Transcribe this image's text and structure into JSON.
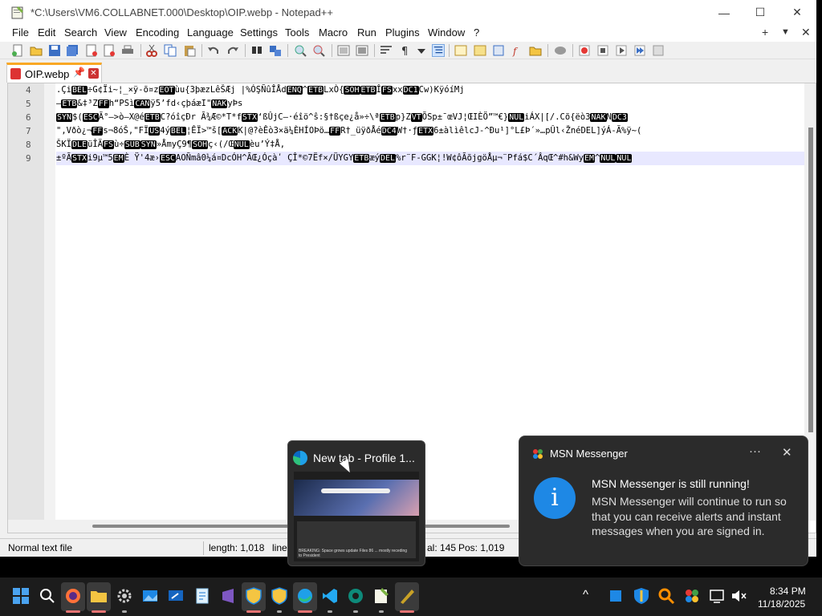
{
  "titlebar": {
    "title": "*C:\\Users\\VM6.COLLABNET.000\\Desktop\\OIP.webp - Notepad++",
    "minimize": "—",
    "maximize": "☐",
    "close": "✕"
  },
  "menu": {
    "items": [
      "File",
      "Edit",
      "Search",
      "View",
      "Encoding",
      "Language",
      "Settings",
      "Tools",
      "Macro",
      "Run",
      "Plugins",
      "Window",
      "?"
    ],
    "right": [
      "+",
      "▼",
      "✕"
    ]
  },
  "tab": {
    "label": "OIP.webp",
    "pin": "📌",
    "close": "✕"
  },
  "editor": {
    "lines": [
      {
        "num": "4",
        "text": ".Çi[BEL]÷G¢Ïi~¦_×ÿ-õ¤z[EOT]ùu{3þæzLêŠÆj |%ÓŞÑûÎÅd[ENQ]^[ETB]LxÒ{[SOH][ETB]Î[FS]xx[DC1]Cw)KÿóíMj"
      },
      {
        "num": "5",
        "text": "—[ETB]&‡³Z[FF]h“PSì[CAN]ÿ5’fd‹çþáæI\"[NAK]yÞs"
      },
      {
        "num": "6",
        "text": "[SYN]$([ESC]Ã°–>ò—X@é[ETB]C?óîçÐr Ã¾Æ©*T*f[STX]‘ßÛjC–·éîö^ŝ:§†ßçe¿å»÷\\ª[ETB]p}Z[VT]ÕSp±¯œVJ¦ŒIÈÖ”™€}[NUL]iÁX|[/.Cõ{ëò3[NAK]N[DC3]"
      },
      {
        "num": "7",
        "text": "\",Vðò¿¬[FF]s¬8óŠ,\"FÏ[US]4ý[BEL]¦ÊÏ>™š[[ACK]K|@?èÊò3×ä¼ÈHÍOÞö…[FF]R†_üÿðÅé[DC4]W†·ƒ[ETX]6±àlìêlcJ-^Ðu¹]°L£Þ´»…pÛl‹ŽnéDEL]ýÁ-Ã%ÿ~("
      },
      {
        "num": "8",
        "text": "ŠKÏ[DLE]üÎÄ[FS]ù÷[SUB][SYN]»ÅmyÇ9¶[SOH]ç‹(/Œ[NUL]èu’Ý‡Å,"
      },
      {
        "num": "9",
        "text": "±ºÃ[STX]i9µ™5[EM]È Ÿ'4æ›[ESC]AOÑmâ0¼á¤DcÓH^ÃŒ¿Óçàʹ ÇÎ*©7Ëf×/ÜYGY[ETB]æý[DEL]%r¨F-GGK¦!W¢ôÃõjgöÅµ¬¨Pfá$C´ÂqŒ^#h&Wy[EM]^[NUL][NUL]"
      }
    ]
  },
  "statusbar": {
    "filetype": "Normal text file",
    "length": "length: 1,018",
    "lines": "line",
    "col": "al: 145",
    "pos": "Pos: 1,019"
  },
  "thumbnail": {
    "title": "New tab - Profile 1...",
    "news_text": "BREAKING: Space grows update Files 86 ... mostly receding to President"
  },
  "toast": {
    "app": "MSN Messenger",
    "more": "···",
    "close": "✕",
    "title": "MSN Messenger is still running!",
    "body": "MSN Messenger will continue to run so that you can receive alerts and instant messages when you are signed in.",
    "big_icon": "i"
  },
  "taskbar": {
    "time": "8:34 PM",
    "date": "11/18/2025",
    "tray_caret": "^"
  }
}
